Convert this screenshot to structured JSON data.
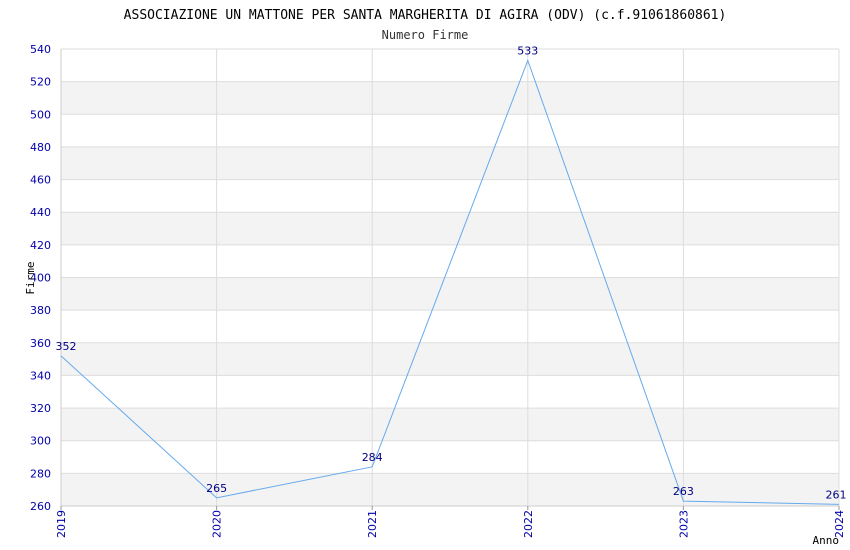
{
  "chart_data": {
    "type": "line",
    "title": "ASSOCIAZIONE UN MATTONE PER SANTA MARGHERITA DI AGIRA (ODV) (c.f.91061860861)",
    "subtitle": "Numero Firme",
    "xlabel": "Anno",
    "ylabel": "Firme",
    "x": [
      "2019",
      "2020",
      "2021",
      "2022",
      "2023",
      "2024"
    ],
    "values": [
      352,
      265,
      284,
      533,
      263,
      261
    ],
    "ylim": [
      260,
      540
    ],
    "yticks": [
      260,
      280,
      300,
      320,
      340,
      360,
      380,
      400,
      420,
      440,
      460,
      480,
      500,
      520,
      540
    ],
    "grid": true,
    "colors": {
      "line": "#66aaee",
      "tick_text": "#0000aa",
      "data_label": "#000080",
      "band": "#f3f3f3",
      "grid": "#dddddd"
    }
  }
}
